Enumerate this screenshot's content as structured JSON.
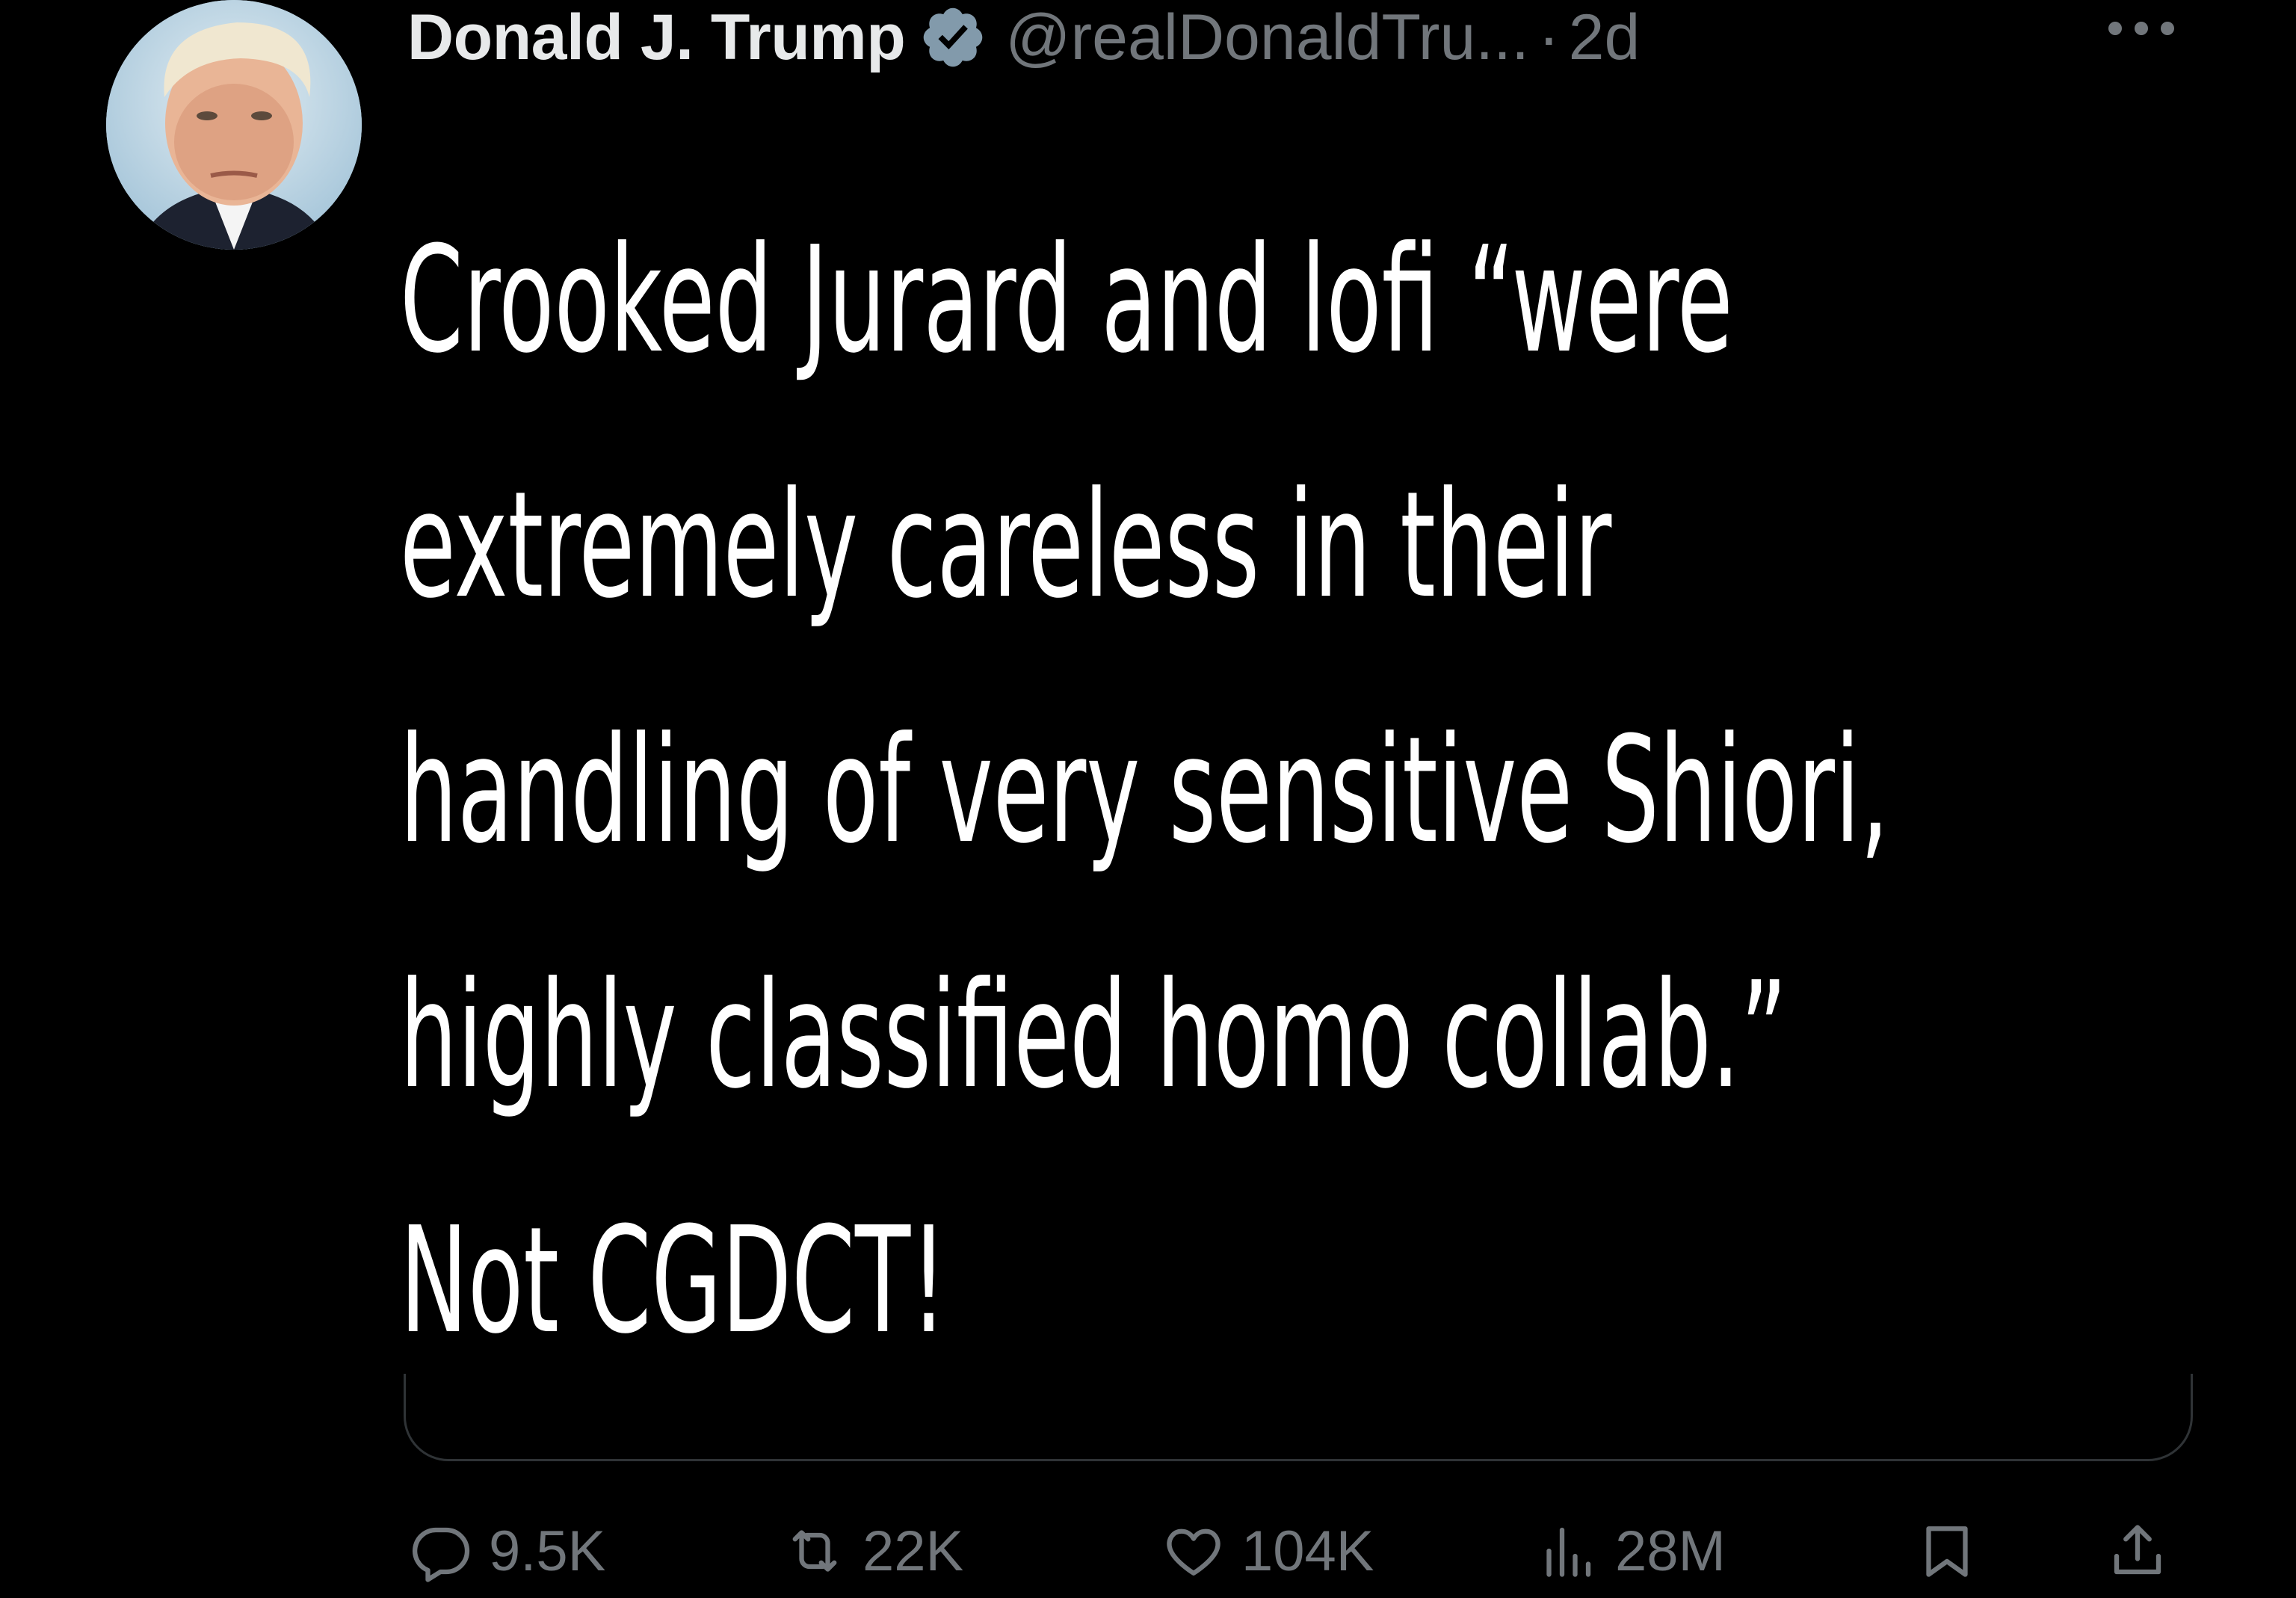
{
  "tweet": {
    "author": {
      "display_name": "Donald J. Trump",
      "handle": "@realDonaldTru...",
      "verified": true
    },
    "separator": "·",
    "timestamp": "2d",
    "text": "Crooked Jurard and lofi “were\nextremely careless in their\nhandling of very sensitive Shiori,\nhighly classified homo collab.”\nNot CGDCT!",
    "actions": {
      "replies": "9.5K",
      "reposts": "22K",
      "likes": "104K",
      "views": "28M"
    }
  },
  "icons": {
    "verified": "verified-badge-icon",
    "more": "more-icon",
    "reply": "reply-icon",
    "repost": "repost-icon",
    "like": "heart-icon",
    "views": "views-icon",
    "bookmark": "bookmark-icon",
    "share": "share-icon"
  },
  "colors": {
    "background": "#000000",
    "text_primary": "#ffffff",
    "text_secondary": "#71767b",
    "verified_badge": "#829aab",
    "divider": "#2f3336"
  }
}
